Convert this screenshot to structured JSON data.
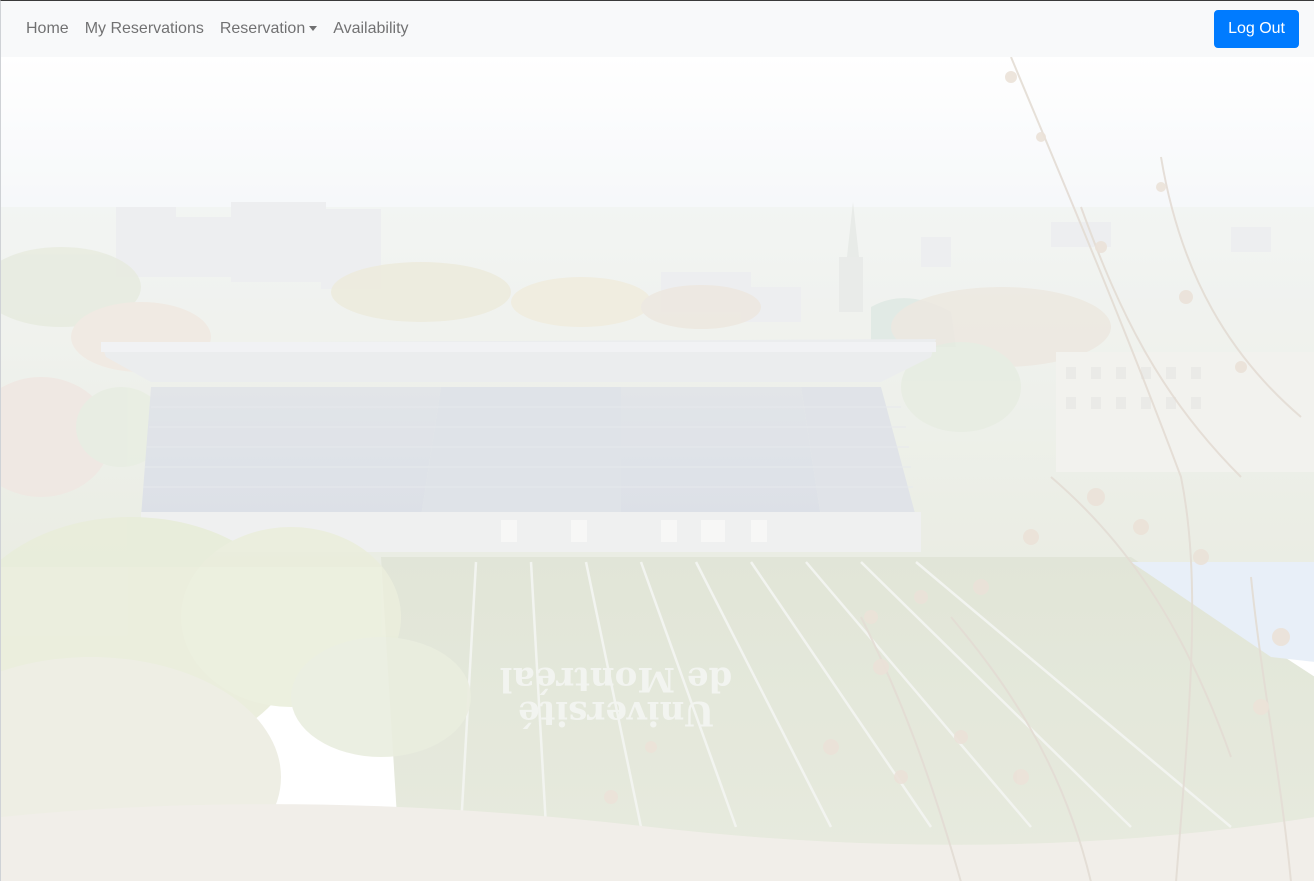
{
  "navbar": {
    "links": [
      {
        "label": "Home"
      },
      {
        "label": "My Reservations"
      },
      {
        "label": "Reservation",
        "has_dropdown": true
      },
      {
        "label": "Availability"
      }
    ],
    "logout_label": "Log Out"
  },
  "hero": {
    "field_lettering": [
      "Université",
      "de Montréal"
    ]
  },
  "colors": {
    "primary": "#007bff",
    "navbar_bg": "#f8f9fa",
    "nav_text": "#7a7b7c"
  }
}
